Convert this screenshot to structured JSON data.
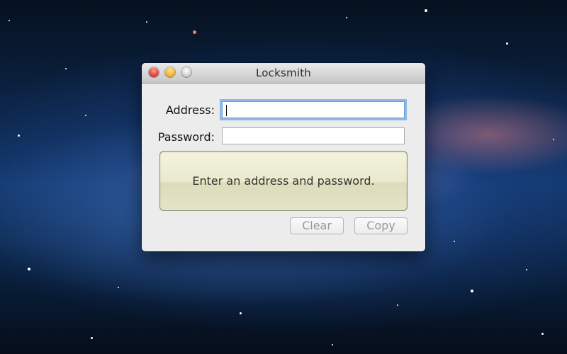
{
  "window": {
    "title": "Locksmith"
  },
  "form": {
    "address_label": "Address:",
    "address_value": "",
    "password_label": "Password:",
    "password_value": ""
  },
  "status": {
    "message": "Enter an address and password."
  },
  "buttons": {
    "clear": "Clear",
    "copy": "Copy"
  },
  "icons": {
    "close": "close-icon",
    "minimize": "minimize-icon",
    "zoom": "zoom-icon"
  },
  "colors": {
    "window_bg": "#ececec",
    "message_bg": "#e9e9cd",
    "focus_ring": "#70a5e6",
    "disabled_text": "#9a9a9a"
  }
}
